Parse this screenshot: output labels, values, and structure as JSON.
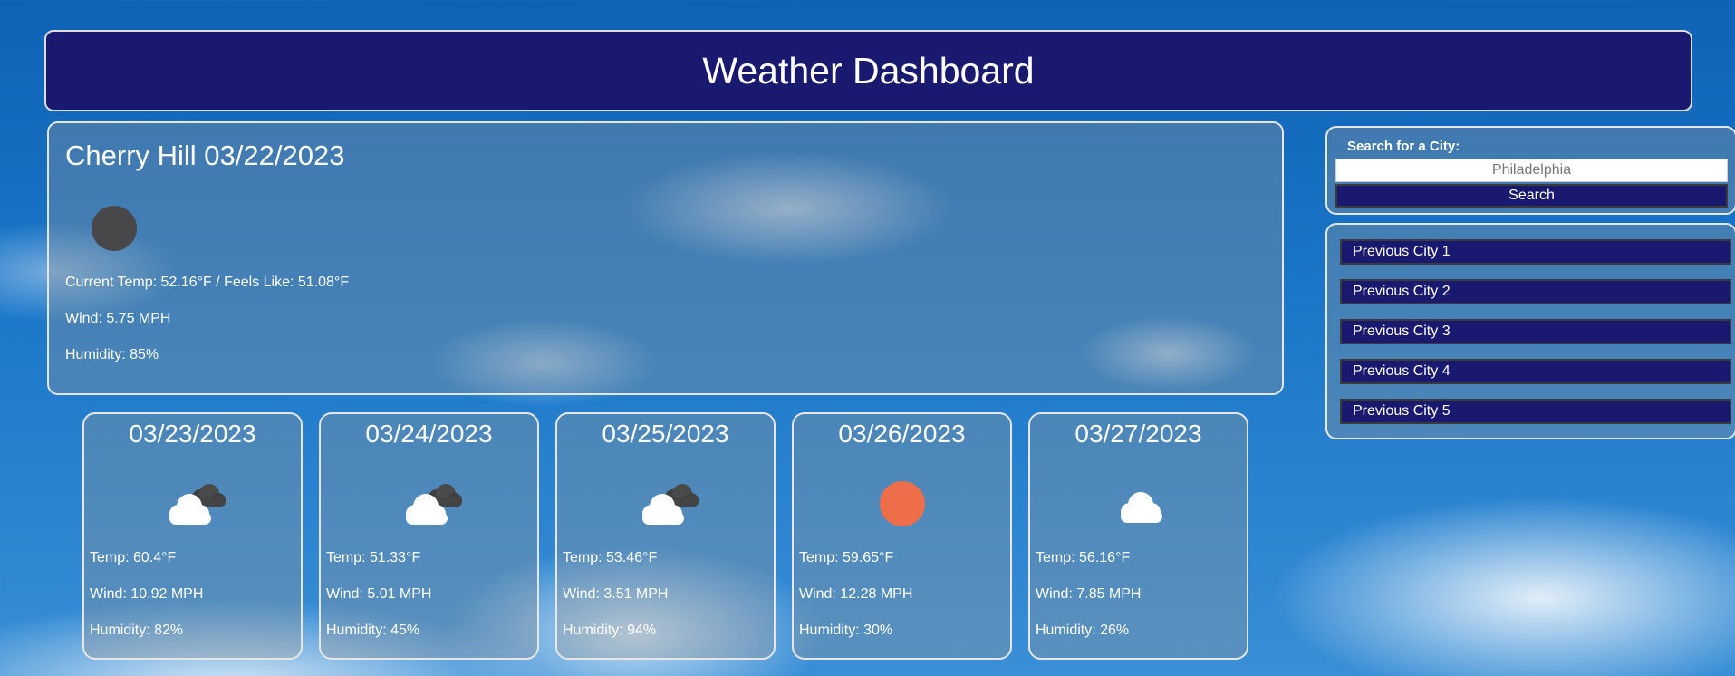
{
  "header": {
    "title": "Weather Dashboard"
  },
  "current": {
    "title": "Cherry Hill 03/22/2023",
    "icon": "dark-circle-icon",
    "temp": "Current Temp: 52.16°F / Feels Like: 51.08°F",
    "wind": "Wind: 5.75 MPH",
    "humidity": "Humidity: 85%"
  },
  "forecast": [
    {
      "date": "03/23/2023",
      "icon": "clouds-icon",
      "temp": "Temp: 60.4°F",
      "wind": "Wind: 10.92 MPH",
      "humidity": "Humidity: 82%"
    },
    {
      "date": "03/24/2023",
      "icon": "clouds-icon",
      "temp": "Temp: 51.33°F",
      "wind": "Wind: 5.01 MPH",
      "humidity": "Humidity: 45%"
    },
    {
      "date": "03/25/2023",
      "icon": "clouds-icon",
      "temp": "Temp: 53.46°F",
      "wind": "Wind: 3.51 MPH",
      "humidity": "Humidity: 94%"
    },
    {
      "date": "03/26/2023",
      "icon": "sun-icon",
      "temp": "Temp: 59.65°F",
      "wind": "Wind: 12.28 MPH",
      "humidity": "Humidity: 30%"
    },
    {
      "date": "03/27/2023",
      "icon": "cloud-icon",
      "temp": "Temp: 56.16°F",
      "wind": "Wind: 7.85 MPH",
      "humidity": "Humidity: 26%"
    }
  ],
  "search": {
    "label": "Search for a City:",
    "placeholder": "Philadelphia",
    "button": "Search"
  },
  "history": [
    "Previous City 1",
    "Previous City 2",
    "Previous City 3",
    "Previous City 4",
    "Previous City 5"
  ],
  "colors": {
    "navy": "#191970",
    "sun": "#ee6e4a",
    "dark_icon": "#48484b"
  }
}
